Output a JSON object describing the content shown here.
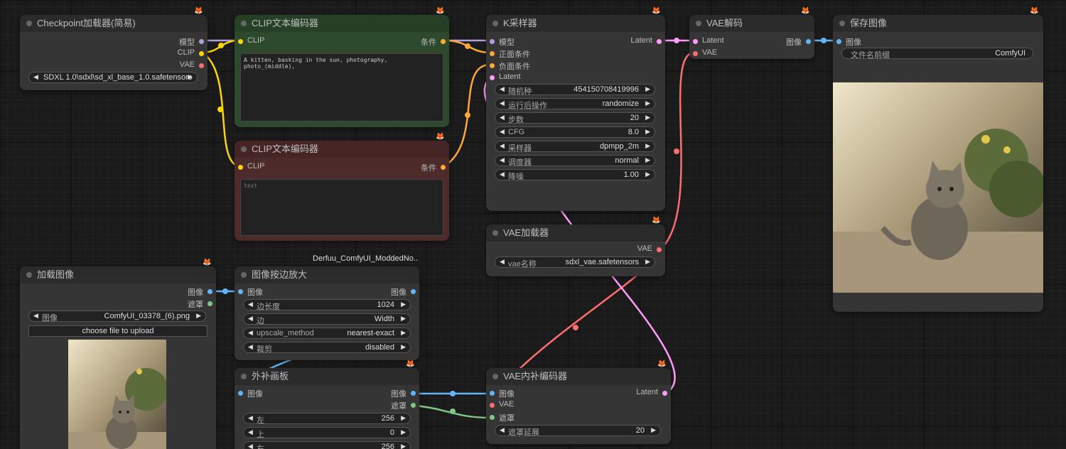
{
  "colors": {
    "model": "#b39ddb",
    "clip": "#ffd500",
    "vae": "#ff6e6e",
    "conditioning": "#ffa931",
    "latent": "#ff9cf9",
    "image": "#64b5f6",
    "mask": "#81c784",
    "positive_node": "#2e4a2e",
    "negative_node": "#4e2b2b"
  },
  "badge_icon": "fox-icon",
  "checkpoint": {
    "title": "Checkpoint加载器(简易)",
    "out_model": "模型",
    "out_clip": "CLIP",
    "out_vae": "VAE",
    "ckpt_value": "SDXL 1.0\\sdxl\\sd_xl_base_1.0.safetensors"
  },
  "clip_pos": {
    "title": "CLIP文本编码器",
    "in_clip": "CLIP",
    "out_cond": "条件",
    "text": "A kitten, basking in the sun, photography, photo_(middle),"
  },
  "clip_neg": {
    "title": "CLIP文本编码器",
    "in_clip": "CLIP",
    "out_cond": "条件",
    "placeholder": "text"
  },
  "ksampler": {
    "title": "K采样器",
    "in_model": "模型",
    "in_pos": "正面条件",
    "in_neg": "负面条件",
    "in_latent": "Latent",
    "out_latent": "Latent",
    "widgets": [
      {
        "label": "随机种",
        "value": "454150708419996"
      },
      {
        "label": "运行后操作",
        "value": "randomize"
      },
      {
        "label": "步数",
        "value": "20"
      },
      {
        "label": "CFG",
        "value": "8.0"
      },
      {
        "label": "采样器",
        "value": "dpmpp_2m"
      },
      {
        "label": "调度器",
        "value": "normal"
      },
      {
        "label": "降噪",
        "value": "1.00"
      }
    ]
  },
  "vae_decode": {
    "title": "VAE解码",
    "in_latent": "Latent",
    "in_vae": "VAE",
    "out_image": "图像"
  },
  "save_image": {
    "title": "保存图像",
    "in_image": "图像",
    "prefix_label": "文件名前缀",
    "prefix_value": "ComfyUI"
  },
  "vae_loader": {
    "title": "VAE加载器",
    "out_vae": "VAE",
    "vae_label": "vae名称",
    "vae_value": "sdxl_vae.safetensors"
  },
  "load_image": {
    "title": "加载图像",
    "out_image": "图像",
    "out_mask": "遮罩",
    "image_label": "图像",
    "image_value": "ComfyUI_03378_(6).png",
    "upload": "choose file to upload"
  },
  "upscale": {
    "title": "图像按边放大",
    "group_label": "Derfuu_ComfyUI_ModdedNo..",
    "in_image": "图像",
    "out_image": "图像",
    "widgets": [
      {
        "label": "边长度",
        "value": "1024"
      },
      {
        "label": "边",
        "value": "Width"
      },
      {
        "label": "upscale_method",
        "value": "nearest-exact"
      },
      {
        "label": "裁剪",
        "value": "disabled"
      }
    ]
  },
  "outpaint": {
    "title": "外补画板",
    "in_image": "图像",
    "out_image": "图像",
    "out_mask": "遮罩",
    "widgets": [
      {
        "label": "左",
        "value": "256"
      },
      {
        "label": "上",
        "value": "0"
      },
      {
        "label": "右",
        "value": "256"
      }
    ]
  },
  "vae_inpaint": {
    "title": "VAE内补编码器",
    "in_image": "图像",
    "in_vae": "VAE",
    "in_mask": "遮罩",
    "out_latent": "Latent",
    "grow_label": "遮罩延展",
    "grow_value": "20"
  }
}
